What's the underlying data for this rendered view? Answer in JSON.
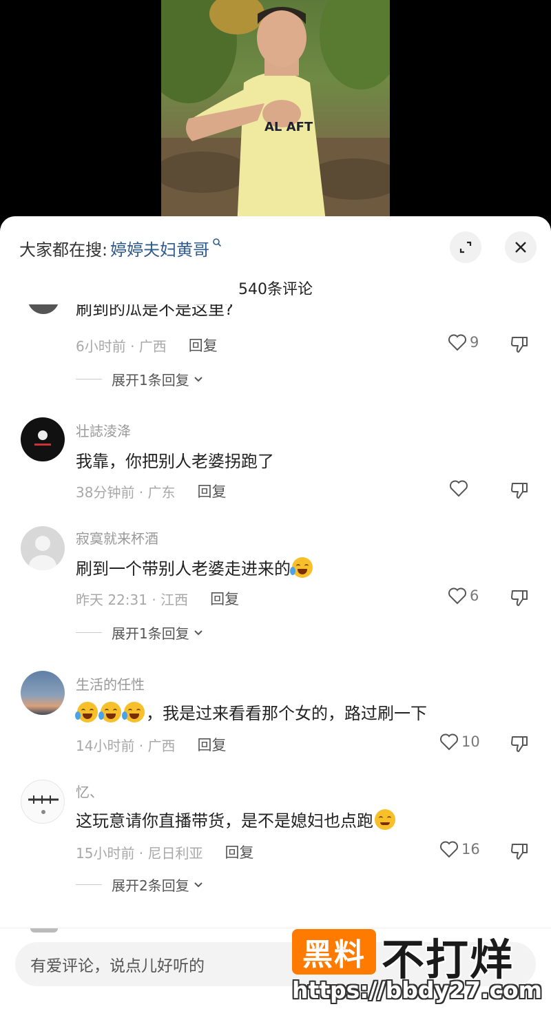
{
  "sheet": {
    "search_prefix": "大家都在搜:",
    "search_term": "婷婷夫妇黄哥",
    "comment_count": "540条评论"
  },
  "partial_comment": {
    "text": "刷到的瓜是不是这里?",
    "time_location": "6小时前 · 广西",
    "reply_label": "回复",
    "likes": "9",
    "expand_label": "展开1条回复"
  },
  "comments": [
    {
      "username": "壮誌淩洚",
      "text": "我靠，你把别人老婆拐跑了",
      "time_location": "38分钟前 · 广东",
      "reply_label": "回复",
      "likes": ""
    },
    {
      "username": "寂寞就来杯酒",
      "text": "刷到一个带别人老婆走进来的",
      "time_location": "昨天 22:31 · 江西",
      "reply_label": "回复",
      "likes": "6",
      "expand_label": "展开1条回复"
    },
    {
      "username": "生活的任性",
      "text": "，我是过来看看那个女的，路过刷一下",
      "time_location": "14小时前 · 广西",
      "reply_label": "回复",
      "likes": "10"
    },
    {
      "username": "忆、",
      "text": "这玩意请你直播带货，是不是媳妇也点跑",
      "time_location": "15小时前 · 尼日利亚",
      "reply_label": "回复",
      "likes": "16",
      "expand_label": "展开2条回复"
    }
  ],
  "input": {
    "placeholder": "有爱评论，说点儿好听的"
  },
  "watermark": {
    "box_text": "黑料",
    "text": "不打烊",
    "url": "https://bbdy27.com",
    "colors": {
      "box": "#ff7a00"
    }
  },
  "icons": {
    "search": "search-icon",
    "expand": "expand-icon",
    "close": "close-icon",
    "like": "heart-icon",
    "dislike": "thumbs-down-icon",
    "chevron": "chevron-down-icon",
    "emoji": "laughing-crying-emoji"
  },
  "colors": {
    "search_term": "#2e5b8f",
    "meta_text": "#a8a8a8",
    "sheet_bg": "#ffffff"
  }
}
